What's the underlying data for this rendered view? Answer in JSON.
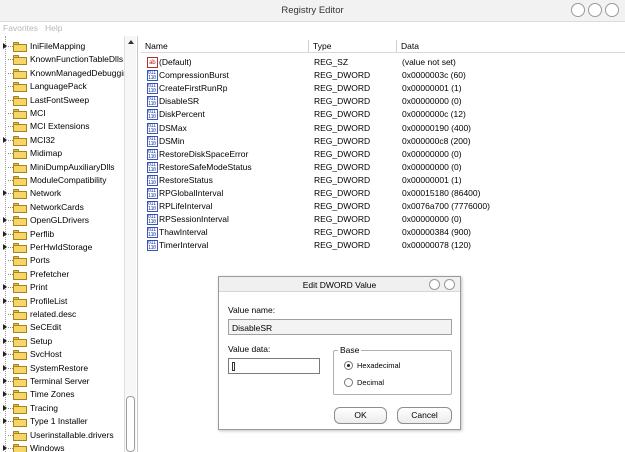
{
  "window": {
    "title": "Registry Editor"
  },
  "menu": {
    "favorites": "Favorites",
    "help": "Help"
  },
  "tree": {
    "items": [
      {
        "label": "IniFileMapping",
        "expandable": true
      },
      {
        "label": "KnownFunctionTableDlls",
        "expandable": false
      },
      {
        "label": "KnownManagedDebuggin",
        "expandable": false
      },
      {
        "label": "LanguagePack",
        "expandable": false
      },
      {
        "label": "LastFontSweep",
        "expandable": false
      },
      {
        "label": "MCI",
        "expandable": false
      },
      {
        "label": "MCI Extensions",
        "expandable": false
      },
      {
        "label": "MCI32",
        "expandable": true
      },
      {
        "label": "Midimap",
        "expandable": false
      },
      {
        "label": "MiniDumpAuxiliaryDlls",
        "expandable": false
      },
      {
        "label": "ModuleCompatibility",
        "expandable": false
      },
      {
        "label": "Network",
        "expandable": true
      },
      {
        "label": "NetworkCards",
        "expandable": false
      },
      {
        "label": "OpenGLDrivers",
        "expandable": true
      },
      {
        "label": "Perflib",
        "expandable": true
      },
      {
        "label": "PerHwIdStorage",
        "expandable": true
      },
      {
        "label": "Ports",
        "expandable": false
      },
      {
        "label": "Prefetcher",
        "expandable": false
      },
      {
        "label": "Print",
        "expandable": true
      },
      {
        "label": "ProfileList",
        "expandable": true
      },
      {
        "label": "related.desc",
        "expandable": false
      },
      {
        "label": "SeCEdit",
        "expandable": true
      },
      {
        "label": "Setup",
        "expandable": true
      },
      {
        "label": "SvcHost",
        "expandable": true
      },
      {
        "label": "SystemRestore",
        "expandable": true
      },
      {
        "label": "Terminal Server",
        "expandable": true
      },
      {
        "label": "Time Zones",
        "expandable": true
      },
      {
        "label": "Tracing",
        "expandable": true
      },
      {
        "label": "Type 1 Installer",
        "expandable": true
      },
      {
        "label": "Userinstallable.drivers",
        "expandable": false
      },
      {
        "label": "Windows",
        "expandable": true
      }
    ]
  },
  "list": {
    "headers": {
      "name": "Name",
      "type": "Type",
      "data": "Data"
    },
    "rows": [
      {
        "name": "(Default)",
        "type": "REG_SZ",
        "data": "(value not set)",
        "icon": "string-value-icon"
      },
      {
        "name": "CompressionBurst",
        "type": "REG_DWORD",
        "data": "0x0000003c (60)",
        "icon": "binary-value-icon"
      },
      {
        "name": "CreateFirstRunRp",
        "type": "REG_DWORD",
        "data": "0x00000001 (1)",
        "icon": "binary-value-icon"
      },
      {
        "name": "DisableSR",
        "type": "REG_DWORD",
        "data": "0x00000000 (0)",
        "icon": "binary-value-icon"
      },
      {
        "name": "DiskPercent",
        "type": "REG_DWORD",
        "data": "0x0000000c (12)",
        "icon": "binary-value-icon"
      },
      {
        "name": "DSMax",
        "type": "REG_DWORD",
        "data": "0x00000190 (400)",
        "icon": "binary-value-icon"
      },
      {
        "name": "DSMin",
        "type": "REG_DWORD",
        "data": "0x000000c8 (200)",
        "icon": "binary-value-icon"
      },
      {
        "name": "RestoreDiskSpaceError",
        "type": "REG_DWORD",
        "data": "0x00000000 (0)",
        "icon": "binary-value-icon"
      },
      {
        "name": "RestoreSafeModeStatus",
        "type": "REG_DWORD",
        "data": "0x00000000 (0)",
        "icon": "binary-value-icon"
      },
      {
        "name": "RestoreStatus",
        "type": "REG_DWORD",
        "data": "0x00000001 (1)",
        "icon": "binary-value-icon"
      },
      {
        "name": "RPGlobalInterval",
        "type": "REG_DWORD",
        "data": "0x00015180 (86400)",
        "icon": "binary-value-icon"
      },
      {
        "name": "RPLifeInterval",
        "type": "REG_DWORD",
        "data": "0x0076a700 (7776000)",
        "icon": "binary-value-icon"
      },
      {
        "name": "RPSessionInterval",
        "type": "REG_DWORD",
        "data": "0x00000000 (0)",
        "icon": "binary-value-icon"
      },
      {
        "name": "ThawInterval",
        "type": "REG_DWORD",
        "data": "0x00000384 (900)",
        "icon": "binary-value-icon"
      },
      {
        "name": "TimerInterval",
        "type": "REG_DWORD",
        "data": "0x00000078 (120)",
        "icon": "binary-value-icon"
      }
    ]
  },
  "dialog": {
    "title": "Edit DWORD Value",
    "value_name_label": "Value name:",
    "value_name": "DisableSR",
    "value_data_label": "Value data:",
    "value_data": "",
    "base_label": "Base",
    "hex_label": "Hexadecimal",
    "dec_label": "Decimal",
    "selected_base": "Hexadecimal",
    "ok_label": "OK",
    "cancel_label": "Cancel"
  }
}
